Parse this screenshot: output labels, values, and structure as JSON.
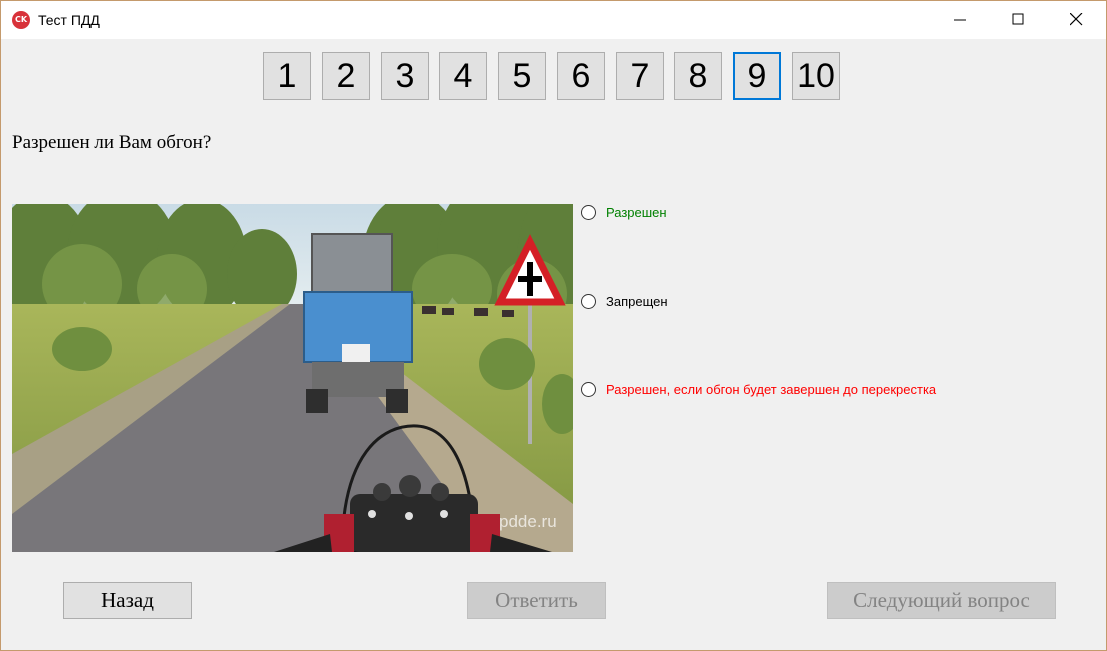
{
  "window": {
    "title": "Тест ПДД",
    "app_icon_text": "CK",
    "border_color": "#c49a6c"
  },
  "question_nav": {
    "items": [
      "1",
      "2",
      "3",
      "4",
      "5",
      "6",
      "7",
      "8",
      "9",
      "10"
    ],
    "active": "9",
    "active_border_color": "#0078d7"
  },
  "question": {
    "text": "Разрешен ли Вам обгон?"
  },
  "scene": {
    "watermark": "pdde.ru",
    "description_icon": "road-scene-image"
  },
  "answers": [
    {
      "label": "Разрешен",
      "color": "#008000"
    },
    {
      "label": "Запрещен",
      "color": "#000000"
    },
    {
      "label": "Разрешен, если обгон будет завершен до перекрестка",
      "color": "#ff0000"
    }
  ],
  "buttons": {
    "back": "Назад",
    "answer": "Ответить",
    "next": "Следующий вопрос"
  }
}
